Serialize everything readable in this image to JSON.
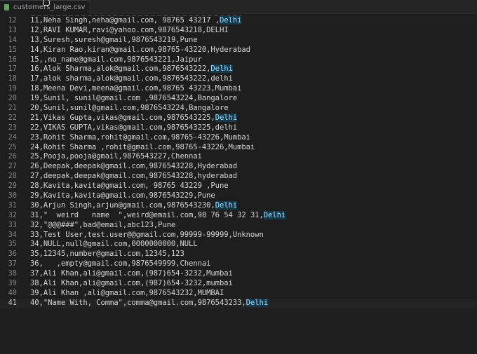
{
  "tab": {
    "filename": "customers_large.csv"
  },
  "editor": {
    "current_line": 41,
    "lines": [
      {
        "number": "12",
        "text": "11,Neha Singh,neha@gmail.com, 98765 43217 ,",
        "highlight": "Delhi"
      },
      {
        "number": "13",
        "text": "12,RAVI KUMAR,ravi@yahoo.com,9876543218,DELHI",
        "highlight": ""
      },
      {
        "number": "14",
        "text": "13,Suresh,suresh@gmail,9876543219,Pune",
        "highlight": ""
      },
      {
        "number": "15",
        "text": "14,Kiran Rao,kiran@gmail.com,98765-43220,Hyderabad",
        "highlight": ""
      },
      {
        "number": "16",
        "text": "15,,no_name@gmail.com,9876543221,Jaipur",
        "highlight": ""
      },
      {
        "number": "17",
        "text": "16,Alok Sharma,alok@gmail.com,9876543222,",
        "highlight": "Delhi"
      },
      {
        "number": "18",
        "text": "17,alok sharma,alok@gmail.com,9876543222,delhi",
        "highlight": ""
      },
      {
        "number": "19",
        "text": "18,Meena Devi,meena@gmail.com,98765 43223,Mumbai",
        "highlight": ""
      },
      {
        "number": "20",
        "text": "19,Sunil, sunil@gmail.com ,9876543224,Bangalore",
        "highlight": ""
      },
      {
        "number": "21",
        "text": "20,Sunil,sunil@gmail.com,9876543224,Bangalore",
        "highlight": ""
      },
      {
        "number": "22",
        "text": "21,Vikas Gupta,vikas@gmail.com,9876543225,",
        "highlight": "Delhi"
      },
      {
        "number": "23",
        "text": "22,VIKAS GUPTA,vikas@gmail.com,9876543225,delhi",
        "highlight": ""
      },
      {
        "number": "24",
        "text": "23,Rohit Sharma,rohit@gmail.com,98765-43226,Mumbai",
        "highlight": ""
      },
      {
        "number": "25",
        "text": "24,Rohit Sharma ,rohit@gmail.com,98765-43226,Mumbai",
        "highlight": ""
      },
      {
        "number": "26",
        "text": "25,Pooja,pooja@gmail,9876543227,Chennai",
        "highlight": ""
      },
      {
        "number": "27",
        "text": "26,Deepak,deepak@gmail.com,9876543228,Hyderabad",
        "highlight": ""
      },
      {
        "number": "28",
        "text": "27,deepak,deepak@gmail.com,9876543228,hyderabad",
        "highlight": ""
      },
      {
        "number": "29",
        "text": "28,Kavita,kavita@gmail.com, 98765 43229 ,Pune",
        "highlight": ""
      },
      {
        "number": "30",
        "text": "29,Kavita,kavita@gmail.com,9876543229,Pune",
        "highlight": ""
      },
      {
        "number": "31",
        "text": "30,Arjun Singh,arjun@gmail.com,9876543230,",
        "highlight": "Delhi"
      },
      {
        "number": "32",
        "text": "31,\"  weird   name  \",weird@email.com,98 76 54 32 31,",
        "highlight": "Delhi"
      },
      {
        "number": "33",
        "text": "32,\"@@@###\",bad@email,abc123,Pune",
        "highlight": ""
      },
      {
        "number": "34",
        "text": "33,Test User,test.user@@gmail.com,99999-99999,Unknown",
        "highlight": ""
      },
      {
        "number": "35",
        "text": "34,NULL,null@gmail.com,0000000000,NULL",
        "highlight": ""
      },
      {
        "number": "36",
        "text": "35,12345,number@gmail.com,12345,123",
        "highlight": ""
      },
      {
        "number": "37",
        "text": "36,   ,empty@gmail.com,9876549999,Chennai",
        "highlight": ""
      },
      {
        "number": "38",
        "text": "37,Ali Khan,ali@gmail.com,(987)654-3232,Mumbai",
        "highlight": ""
      },
      {
        "number": "39",
        "text": "38,Ali Khan,ali@gmail.com,(987)654-3232,mumbai",
        "highlight": ""
      },
      {
        "number": "40",
        "text": "39,Ali Khan ,ali@gmail.com,9876543232,MUMBAI",
        "highlight": ""
      },
      {
        "number": "41",
        "text": "40,\"Name With, Comma\",comma@gmail.com,9876543233,",
        "highlight": "Delhi"
      }
    ]
  }
}
